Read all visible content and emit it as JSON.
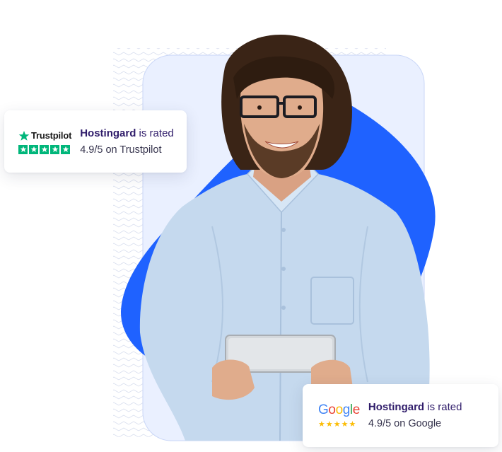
{
  "trustpilot_card": {
    "logo_text": "Trustpilot",
    "logo_icon": "trustpilot-star-icon",
    "stars": 5,
    "brand": "Hostingard",
    "rated_suffix": " is rated",
    "score_text": "4.9/5 on Trustpilot",
    "star_color": "#00b67a"
  },
  "google_card": {
    "logo_letters": [
      "G",
      "o",
      "o",
      "g",
      "l",
      "e"
    ],
    "logo_colors": [
      "#4285f4",
      "#ea4335",
      "#fbbc05",
      "#4285f4",
      "#34a853",
      "#ea4335"
    ],
    "stars": 5,
    "brand": "Hostingard",
    "rated_suffix": " is rated",
    "score_text": "4.9/5 on Google",
    "star_color": "#fbbc04"
  },
  "colors": {
    "accent_blue": "#1f62ff",
    "panel_light": "#eaf0ff",
    "shirt": "#c5d9ee",
    "hair": "#3a2416",
    "tablet": "#d4d8dc"
  }
}
